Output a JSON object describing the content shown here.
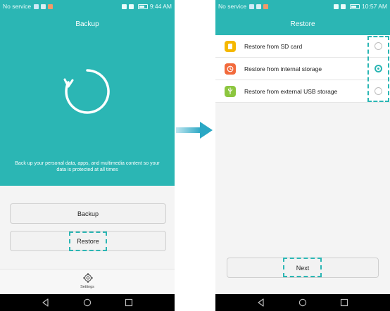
{
  "left_screen": {
    "status": {
      "carrier": "No service",
      "time": "9:44 AM"
    },
    "title": "Backup",
    "description": "Back up your personal data, apps, and multimedia content so your data is protected at all times",
    "backup_button": "Backup",
    "restore_button": "Restore",
    "settings_label": "Settings"
  },
  "right_screen": {
    "status": {
      "carrier": "No service",
      "time": "10:57 AM"
    },
    "title": "Restore",
    "options": [
      {
        "label": "Restore from SD card",
        "icon": "sd-card-icon",
        "icon_color": "#f5b800",
        "selected": false
      },
      {
        "label": "Restore from internal storage",
        "icon": "internal-storage-icon",
        "icon_color": "#f26a3c",
        "selected": true
      },
      {
        "label": "Restore from external USB storage",
        "icon": "usb-icon",
        "icon_color": "#8cc63f",
        "selected": false
      }
    ],
    "next_button": "Next"
  },
  "colors": {
    "accent": "#2bb6b4",
    "highlight_dash": "#2bb6b4"
  }
}
